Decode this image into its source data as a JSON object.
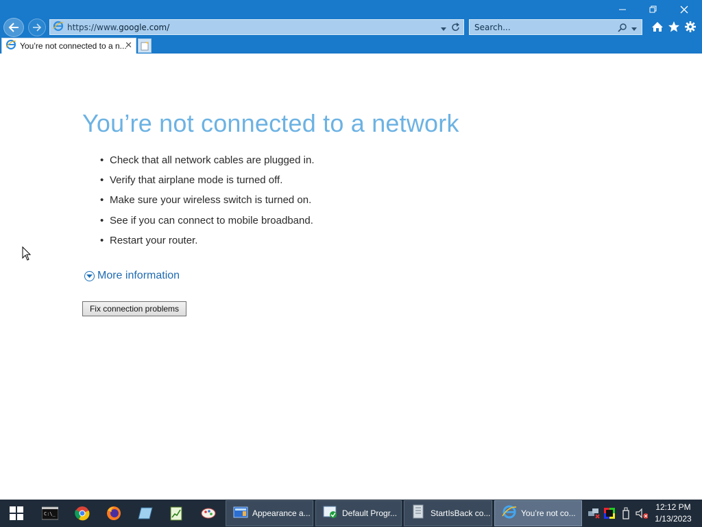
{
  "browser": {
    "url_prefix": "https://www.",
    "url_domain": "google.com/",
    "search_placeholder": "Search...",
    "tab_title": "You’re not connected to a n...",
    "tab_close": "✕"
  },
  "page": {
    "title": "You’re not connected to a network",
    "tips": [
      "Check that all network cables are plugged in.",
      "Verify that airplane mode is turned off.",
      "Make sure your wireless switch is turned on.",
      "See if you can connect to mobile broadband.",
      "Restart your router."
    ],
    "more_info": "More information",
    "fix_button": "Fix connection problems"
  },
  "taskbar": {
    "tasks": [
      {
        "label": "Appearance a...",
        "icon": "appearance-icon"
      },
      {
        "label": "Default Progr...",
        "icon": "default-programs-icon"
      },
      {
        "label": "StartIsBack co...",
        "icon": "startisback-icon"
      },
      {
        "label": "You’re not co...",
        "icon": "internet-explorer-icon"
      }
    ],
    "time": "12:12 PM",
    "date": "1/13/2023"
  },
  "colors": {
    "chrome": "#1979ca",
    "title_blue": "#6cb2e3",
    "link_blue": "#1f6ab1",
    "taskbar": "#1f2b39"
  }
}
